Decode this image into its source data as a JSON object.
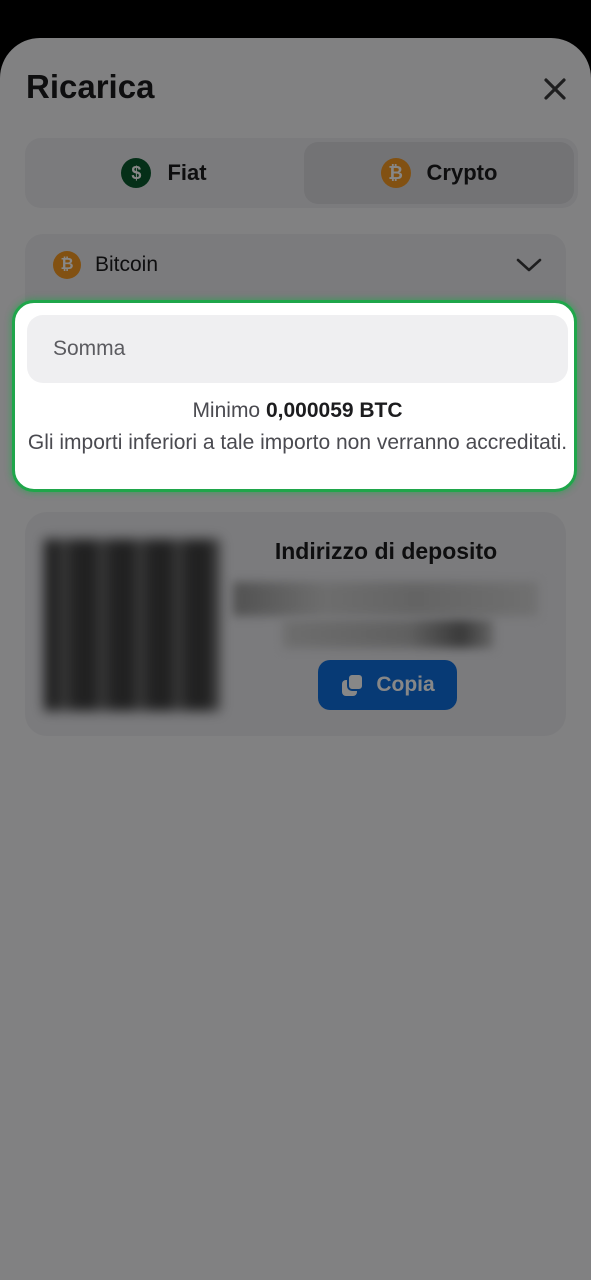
{
  "header": {
    "title": "Ricarica",
    "close_icon": "close-icon"
  },
  "tabs": [
    {
      "label": "Fiat",
      "icon": "dollar-coin-icon",
      "selected": false
    },
    {
      "label": "Crypto",
      "icon": "bitcoin-icon",
      "selected": true
    }
  ],
  "currency_select": {
    "selected": "Bitcoin",
    "icon": "bitcoin-icon"
  },
  "amount": {
    "placeholder": "Somma",
    "value": "",
    "min_label": "Minimo",
    "min_value": "0,000059 BTC",
    "warning": "Gli importi inferiori a tale importo non verranno accreditati."
  },
  "deposit": {
    "title": "Indirizzo di deposito",
    "copy_label": "Copia",
    "copy_icon": "copy-icon"
  },
  "colors": {
    "accent_blue": "#0f6fde",
    "highlight_green": "#1fa64a",
    "bitcoin_orange": "#f59a23",
    "dollar_green": "#0b5a2e"
  }
}
